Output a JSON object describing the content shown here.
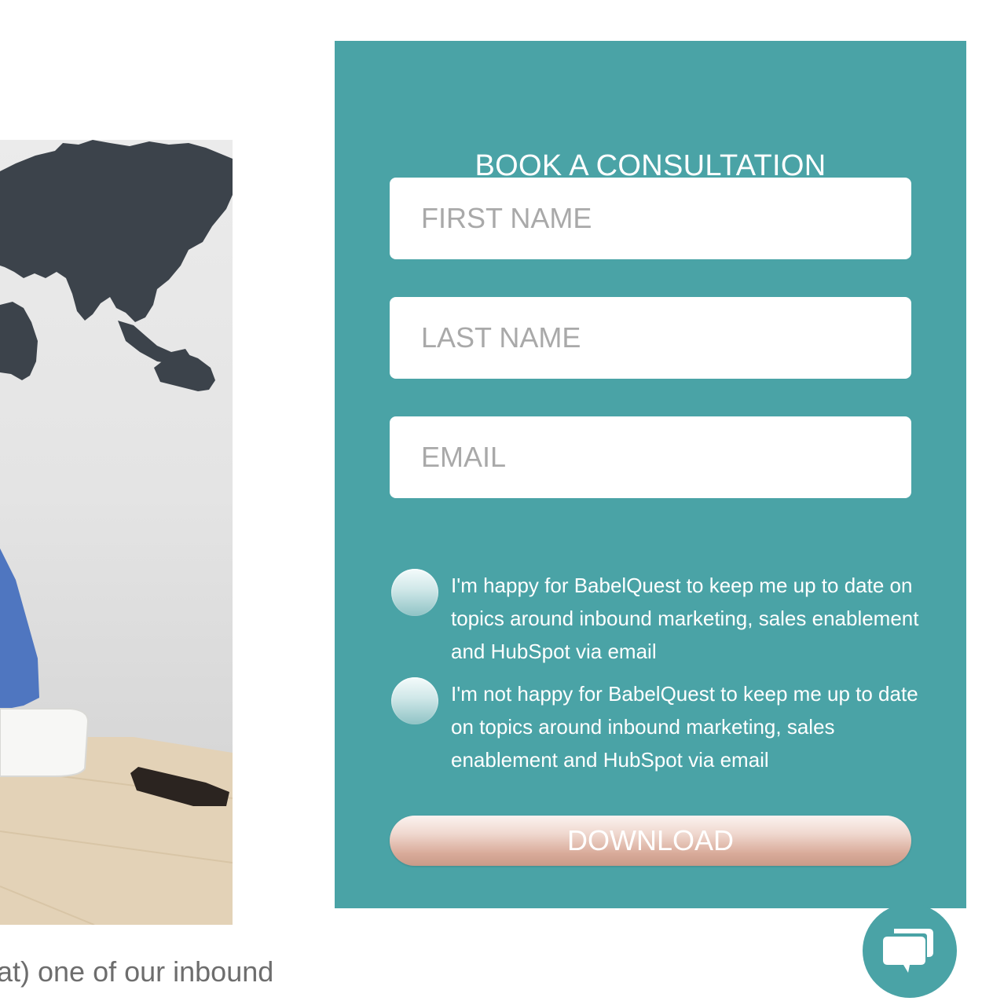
{
  "photo": {
    "alt_icon": "office-photo-with-world-map"
  },
  "caption": {
    "text": "at) one of our inbound"
  },
  "form": {
    "title": "BOOK A CONSULTATION",
    "first_name_placeholder": "FIRST NAME",
    "last_name_placeholder": "LAST NAME",
    "email_placeholder": "EMAIL",
    "consent_yes": "I'm happy for BabelQuest to keep me up to date on topics around inbound marketing, sales enablement and HubSpot via email",
    "consent_no": "I'm not happy for BabelQuest to keep me up to date on topics around inbound marketing, sales enablement and HubSpot via email",
    "submit_label": "DOWNLOAD"
  },
  "chat": {
    "icon": "chat-bubbles-icon"
  },
  "colors": {
    "panel": "#4aa3a6",
    "button_gradient_end": "#c99a88"
  }
}
